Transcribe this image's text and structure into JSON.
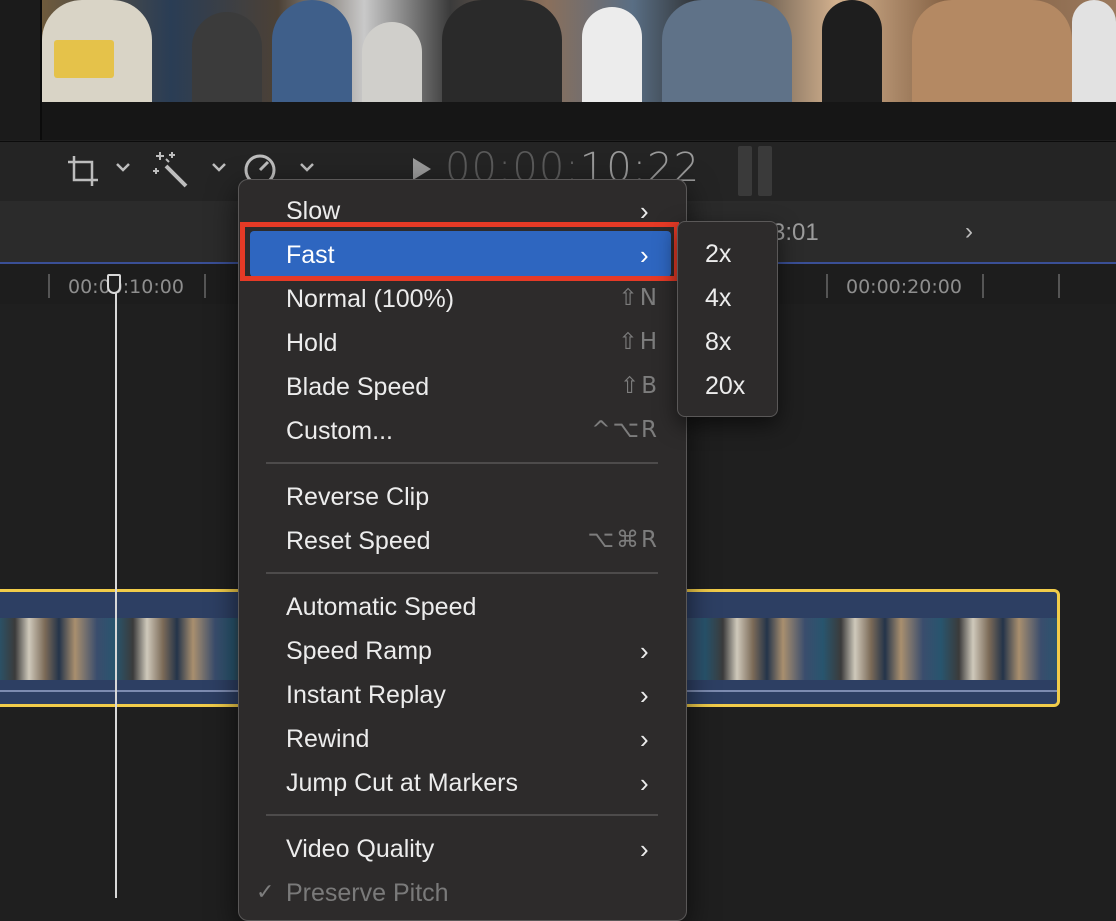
{
  "viewer": {
    "timecode_dim": "00:00:",
    "timecode_bright": "10:22"
  },
  "toolbar": {
    "crop_icon": "crop-icon",
    "effects_icon": "magic-wand-icon",
    "speed_icon": "speedometer-icon",
    "chevron": "⌄"
  },
  "timeline_header": {
    "time": "3:01",
    "next_chevron": "›"
  },
  "ruler": {
    "labels": [
      "00:00:10:00",
      "00:00:20:00"
    ]
  },
  "speed_menu": {
    "items": [
      {
        "label": "Slow",
        "shortcut": "",
        "submenu": true
      },
      {
        "label": "Fast",
        "shortcut": "",
        "submenu": true,
        "highlighted": true
      },
      {
        "label": "Normal (100%)",
        "shortcut": "⇧N",
        "submenu": false
      },
      {
        "label": "Hold",
        "shortcut": "⇧H",
        "submenu": false
      },
      {
        "label": "Blade Speed",
        "shortcut": "⇧B",
        "submenu": false
      },
      {
        "label": "Custom...",
        "shortcut": "^⌥R",
        "submenu": false
      },
      {
        "label": "Reverse Clip",
        "shortcut": "",
        "submenu": false
      },
      {
        "label": "Reset Speed",
        "shortcut": "⌥⌘R",
        "submenu": false
      },
      {
        "label": "Automatic Speed",
        "shortcut": "",
        "submenu": false
      },
      {
        "label": "Speed Ramp",
        "shortcut": "",
        "submenu": true
      },
      {
        "label": "Instant Replay",
        "shortcut": "",
        "submenu": true
      },
      {
        "label": "Rewind",
        "shortcut": "",
        "submenu": true
      },
      {
        "label": "Jump Cut at Markers",
        "shortcut": "",
        "submenu": true
      },
      {
        "label": "Video Quality",
        "shortcut": "",
        "submenu": true
      },
      {
        "label": "Preserve Pitch",
        "shortcut": "",
        "submenu": false,
        "checked": true,
        "disabled": true
      }
    ],
    "chevron": "›",
    "check": "✓"
  },
  "fast_submenu": {
    "items": [
      "2x",
      "4x",
      "8x",
      "20x"
    ]
  },
  "colors": {
    "highlight": "#2e66c0",
    "annotation_outline": "#e63a26",
    "clip_border": "#f1cc4a"
  }
}
